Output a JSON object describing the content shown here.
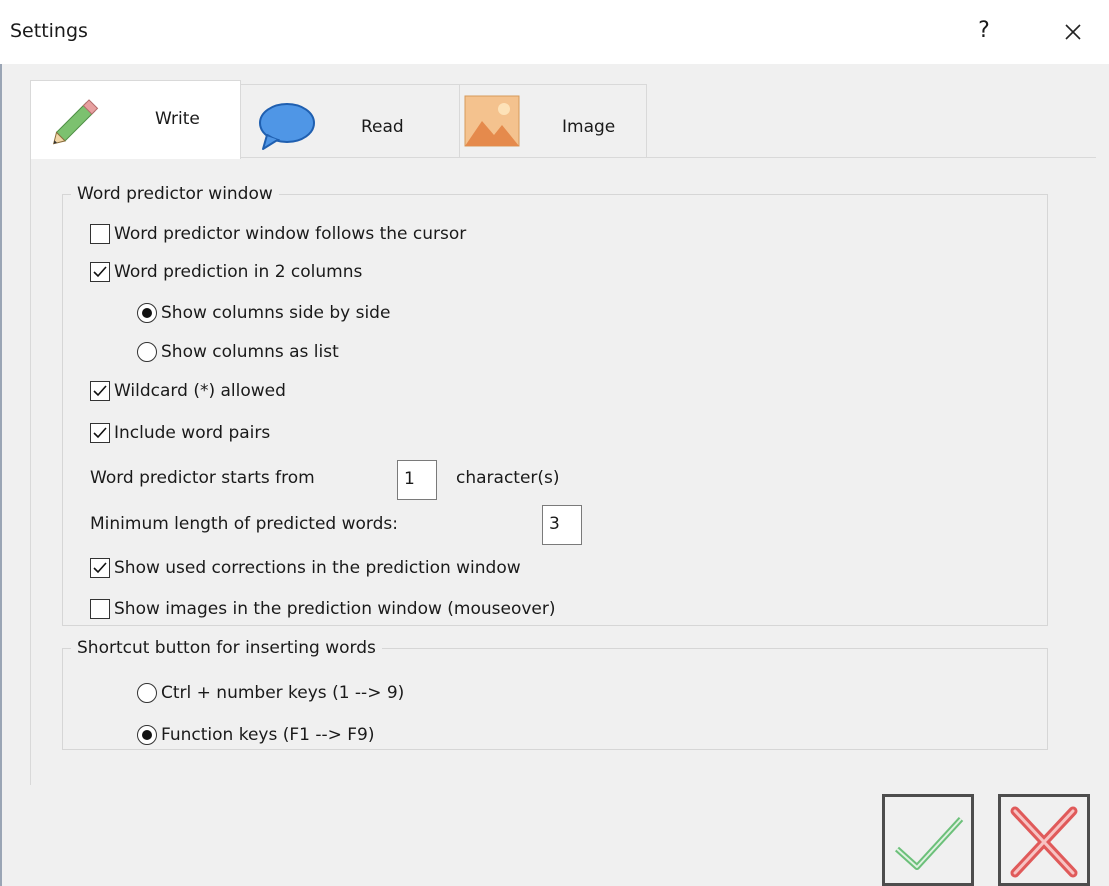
{
  "window": {
    "title": "Settings",
    "help_label": "?"
  },
  "tabs": [
    {
      "label": "Write",
      "icon": "pencil-icon",
      "active": true
    },
    {
      "label": "Read",
      "icon": "speech-bubble-icon",
      "active": false
    },
    {
      "label": "Image",
      "icon": "image-icon",
      "active": false
    }
  ],
  "predictor_group": {
    "legend": "Word predictor window",
    "follows_cursor": {
      "label": "Word predictor window follows the cursor",
      "checked": false
    },
    "two_columns": {
      "label": "Word prediction in 2 columns",
      "checked": true
    },
    "side_by_side": {
      "label": "Show columns side by side",
      "selected": true
    },
    "as_list": {
      "label": "Show columns as list",
      "selected": false
    },
    "wildcard": {
      "label": "Wildcard (*) allowed",
      "checked": true
    },
    "word_pairs": {
      "label": "Include word pairs",
      "checked": true
    },
    "starts_from_label": "Word predictor starts from",
    "starts_from_value": "1",
    "starts_from_unit": "character(s)",
    "min_length_label": "Minimum length of predicted words:",
    "min_length_value": "3",
    "used_corrections": {
      "label": "Show used corrections in the prediction window",
      "checked": true
    },
    "show_images": {
      "label": "Show images in the prediction window (mouseover)",
      "checked": false
    }
  },
  "shortcut_group": {
    "legend": "Shortcut button for inserting words",
    "ctrl_keys": {
      "label": "Ctrl + number keys (1 --> 9)",
      "selected": false
    },
    "function_keys": {
      "label": "Function keys (F1 --> F9)",
      "selected": true
    }
  },
  "buttons": {
    "ok_icon": "checkmark-icon",
    "cancel_icon": "red-x-icon"
  },
  "colors": {
    "ok_green": "#6cc07a",
    "cancel_red": "#e05a5a"
  }
}
